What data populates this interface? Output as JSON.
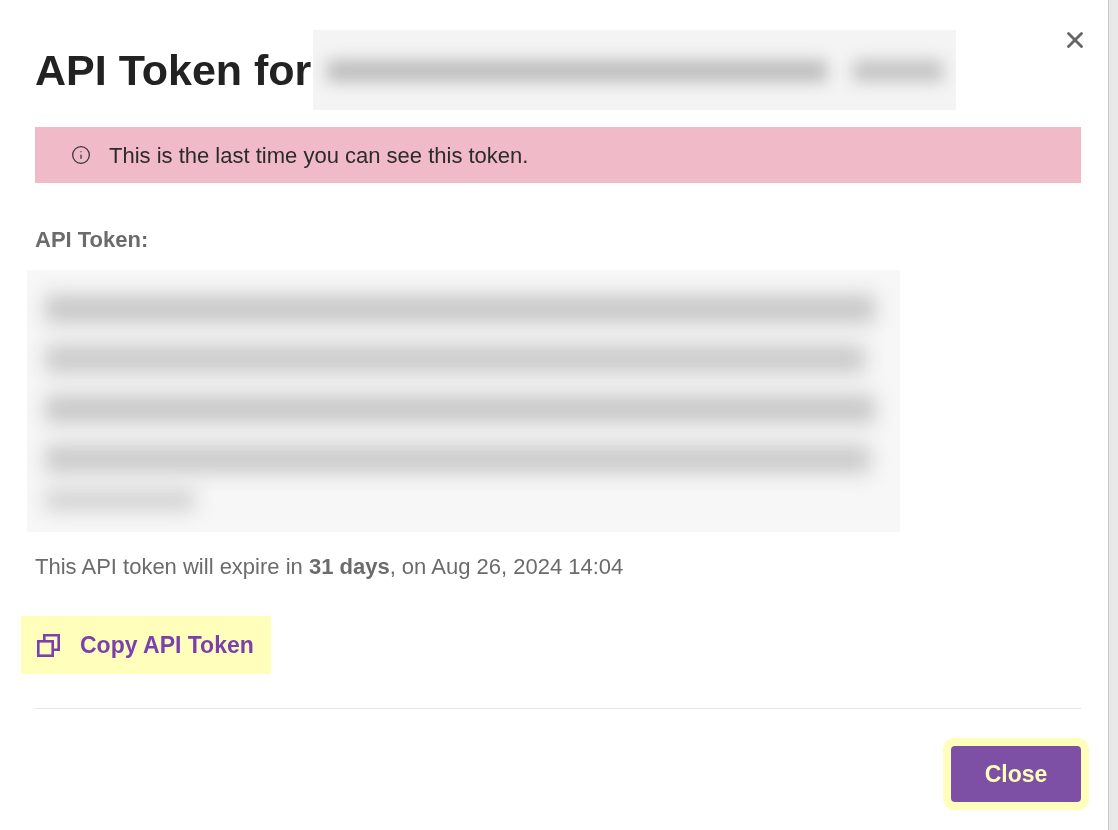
{
  "dialog": {
    "title": "API Token for"
  },
  "alert": {
    "text": "This is the last time you can see this token."
  },
  "token": {
    "label": "API Token:"
  },
  "expiry": {
    "text": "This API token will expire in **31 days**, on Aug 26, 2024 14:04"
  },
  "copy_button": {
    "label": "Copy API Token",
    "highlighted": true
  },
  "footer": {
    "buttons": [
      {
        "label": "Close",
        "highlighted": true
      }
    ]
  }
}
